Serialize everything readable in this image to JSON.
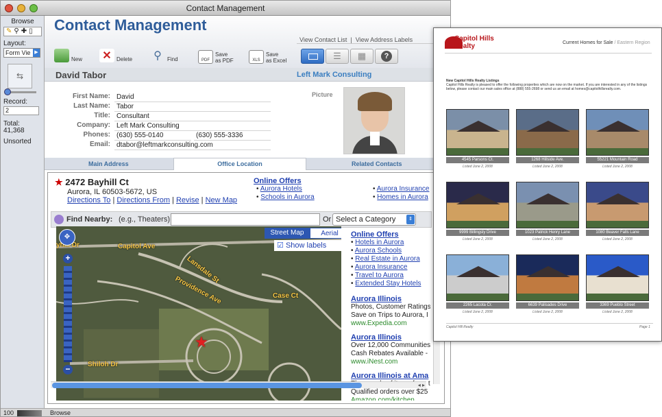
{
  "window": {
    "title": "Contact Management"
  },
  "sidebar": {
    "mode_label": "Browse",
    "layout_label": "Layout:",
    "layout_value": "Form Vie",
    "record_label": "Record:",
    "record_value": "2",
    "total_label": "Total:",
    "total_value": "41,368",
    "sort_state": "Unsorted"
  },
  "status_bar": {
    "zoom": "100",
    "mode": "Browse"
  },
  "header": {
    "app_title": "Contact Management",
    "link_contact_list": "View Contact List",
    "link_separator": "|",
    "link_address_labels": "View Address Labels"
  },
  "toolbar": {
    "new": "New",
    "delete": "Delete",
    "find": "Find",
    "save_pdf_1": "Save",
    "save_pdf_2": "as PDF",
    "save_excel_1": "Save",
    "save_excel_2": "as Excel",
    "pdf_badge": "PDF",
    "xls_badge": "XLS"
  },
  "record": {
    "name": "David Tabor",
    "company_heading": "Left Mark Consulting",
    "picture_label": "Picture"
  },
  "fields": [
    {
      "label": "First Name:",
      "value": "David"
    },
    {
      "label": "Last Name:",
      "value": "Tabor"
    },
    {
      "label": "Title:",
      "value": "Consultant"
    },
    {
      "label": "Company:",
      "value": "Left Mark Consulting"
    },
    {
      "label": "Phones:",
      "value": "(630) 555-0140",
      "value2": "(630) 555-3336"
    },
    {
      "label": "Email:",
      "value": "dtabor@leftmarkconsulting.com"
    }
  ],
  "tabs": [
    "Main Address",
    "Office Location",
    "Related Contacts"
  ],
  "web": {
    "address_line1": "2472 Bayhill Ct",
    "address_line2": "Aurora, IL 60503-5672, US",
    "links": [
      "Directions To",
      "|",
      "Directions From",
      "|",
      "Revise",
      "|",
      "New Map"
    ],
    "offers_title": "Online Offers",
    "offers_col1": [
      "Aurora Hotels",
      "Schools in Aurora"
    ],
    "offers_col2": [
      "Aurora Insurance",
      "Homes in Aurora"
    ],
    "find_nearby_label": "Find Nearby:",
    "find_nearby_hint": "(e.g., Theaters)",
    "or_label": "Or",
    "category_select": "Select a Category",
    "map_tab_street": "Street Map",
    "map_tab_aerial": "Aerial Image",
    "show_labels": "Show labels",
    "street_labels": [
      "Capitol Ave",
      "Lansdale St",
      "Providence Ave",
      "Case Ct",
      "Shiloh Dr",
      "yhill Dr"
    ],
    "right_offers_title": "Online Offers",
    "right_offers": [
      "Hotels in Aurora",
      "Aurora Schools",
      "Real Estate in Aurora",
      "Aurora Insurance",
      "Travel to Aurora",
      "Extended Stay Hotels"
    ],
    "ads": [
      {
        "title": "Aurora Illinois",
        "lines": [
          "Photos, Customer Ratings",
          "Save on Trips to Aurora, I"
        ],
        "url": "www.Expedia.com"
      },
      {
        "title": "Aurora Illinois",
        "lines": [
          "Over 12,000 Communities",
          "Cash Rebates Available -"
        ],
        "url": "www.iNest.com"
      },
      {
        "title": "Aurora Illinois at Ama",
        "lines": [
          "Thousands of items from t",
          "Qualified orders over $25"
        ],
        "url": "Amazon.com/kitchen"
      }
    ]
  },
  "doc": {
    "logo_line1": "Capitol Hills",
    "logo_line2": "Realty",
    "heading": "Current Homes for Sale",
    "heading_sep": " / ",
    "heading_region": "Eastern Region",
    "intro_title": "New Capitol Hills Realty Listings",
    "intro_text": "Capitol Hills Realty is pleased to offer the following properties which are now on the market. If you are interested in any of the listings below, please contact our main sales office at (888) 555-2698 or send us an email at homes@capitolhillsrealty.com.",
    "homes": [
      {
        "addr": "4545 Parsons Ct.",
        "date": "Listed June 2, 2008"
      },
      {
        "addr": "1268 Hillside Ave.",
        "date": "Listed June 2, 2008"
      },
      {
        "addr": "55221 Mountain Road",
        "date": "Listed June 2, 2008"
      },
      {
        "addr": "9999 Billingsly Drive",
        "date": "Listed June 2, 2008"
      },
      {
        "addr": "1023 Patrick Henry Lane",
        "date": "Listed June 2, 2008"
      },
      {
        "addr": "1080 Beaver Falls Lane",
        "date": "Listed June 2, 2008"
      },
      {
        "addr": "2265 Lacota Cr.",
        "date": "Listed June 2, 2008"
      },
      {
        "addr": "6639 Palisades Drive",
        "date": "Listed June 2, 2008"
      },
      {
        "addr": "3369 Pueblo Street",
        "date": "Listed June 2, 2008"
      }
    ],
    "footer_left": "Capitol Hill Realty",
    "footer_right": "Page 1"
  }
}
